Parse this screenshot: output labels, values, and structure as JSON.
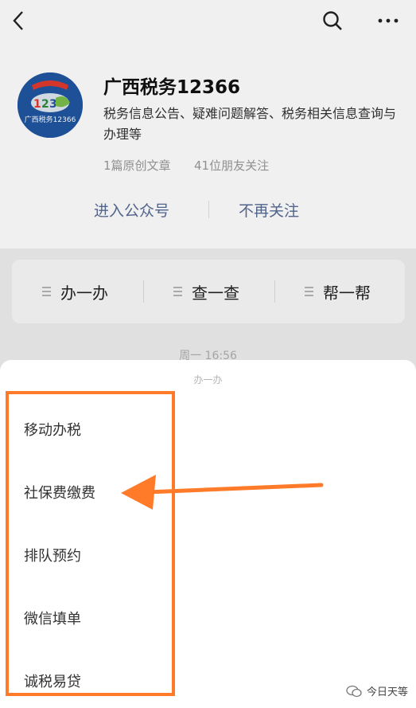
{
  "navbar": {
    "back_icon": "back-arrow-icon",
    "search_icon": "search-icon",
    "more_icon": "more-dots-icon"
  },
  "account": {
    "name": "广西税务12366",
    "description": "税务信息公告、疑难问题解答、税务相关信息查询与办理等",
    "original_articles": "1篇原创文章",
    "friends_following": "41位朋友关注",
    "enter_label": "进入公众号",
    "unfollow_label": "不再关注",
    "avatar_text": "广西税务12366"
  },
  "menu": {
    "items": [
      {
        "label": "办一办"
      },
      {
        "label": "查一查"
      },
      {
        "label": "帮一帮"
      }
    ]
  },
  "chat": {
    "timestamp": "周一 16:56"
  },
  "sheet": {
    "title": "办一办",
    "items": [
      {
        "label": "移动办税"
      },
      {
        "label": "社保费缴费"
      },
      {
        "label": "排队预约"
      },
      {
        "label": "微信填单"
      },
      {
        "label": "诚税易贷"
      }
    ]
  },
  "watermark": {
    "text": "今日天等"
  },
  "colors": {
    "annotation": "#ff7b29",
    "link": "#576b95",
    "avatar": "#1f56a0"
  }
}
